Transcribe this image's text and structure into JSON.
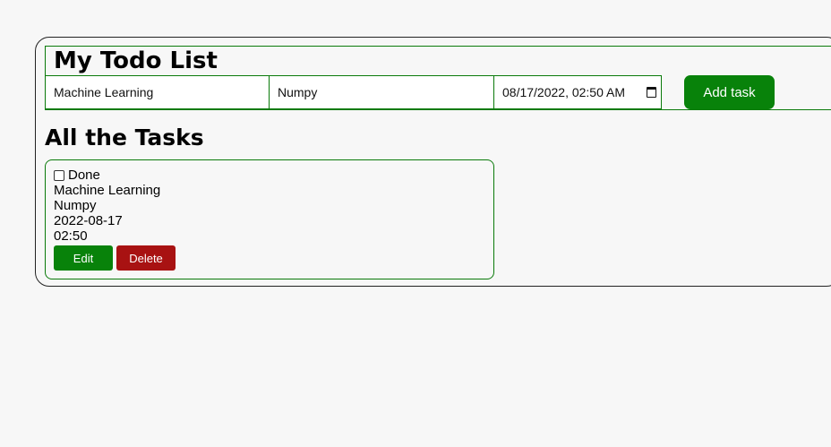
{
  "header": {
    "title": "My Todo List"
  },
  "form": {
    "task_value": "Machine Learning",
    "description_value": "Numpy",
    "datetime_value": "08/17/2022, 02:50  AM",
    "add_label": "Add task"
  },
  "tasks_section": {
    "title": "All the Tasks"
  },
  "tasks": [
    {
      "done_label": "Done",
      "done": false,
      "title": "Machine Learning",
      "description": "Numpy",
      "date": "2022-08-17",
      "time": "02:50",
      "edit_label": "Edit",
      "delete_label": "Delete"
    }
  ],
  "colors": {
    "accent_green": "#08820a",
    "danger_red": "#a81212"
  }
}
